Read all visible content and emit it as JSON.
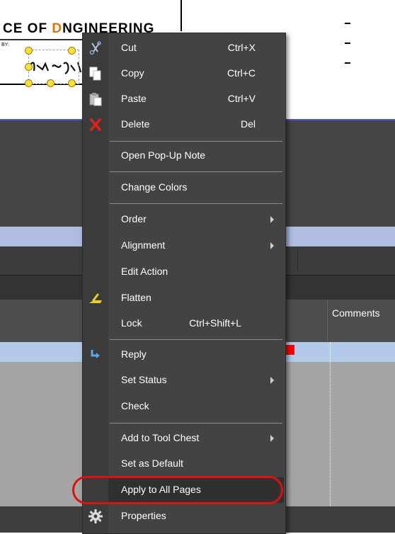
{
  "document": {
    "title_prefix": "CE OF ",
    "title_highlight": "D",
    "title_suffix": "NGINEERING",
    "small_label": "BY:",
    "dashes": [
      "-",
      "-",
      "-"
    ]
  },
  "grid": {
    "comments_header": "Comments"
  },
  "context_menu": {
    "items": [
      {
        "label": "Cut",
        "shortcut": "Ctrl+X",
        "icon": "scissors-icon"
      },
      {
        "label": "Copy",
        "shortcut": "Ctrl+C",
        "icon": "copy-icon"
      },
      {
        "label": "Paste",
        "shortcut": "Ctrl+V",
        "icon": "paste-icon"
      },
      {
        "label": "Delete",
        "shortcut": "Del",
        "icon": "delete-x-icon"
      },
      {
        "label": "Open Pop-Up Note",
        "shortcut": "",
        "icon": ""
      },
      {
        "label": "Change Colors",
        "shortcut": "",
        "icon": ""
      },
      {
        "label": "Order",
        "shortcut": "",
        "icon": "",
        "submenu": true
      },
      {
        "label": "Alignment",
        "shortcut": "",
        "icon": "",
        "submenu": true
      },
      {
        "label": "Edit Action",
        "shortcut": "",
        "icon": ""
      },
      {
        "label": "Flatten",
        "shortcut": "",
        "icon": "flatten-icon"
      },
      {
        "label": "Lock",
        "shortcut": "Ctrl+Shift+L",
        "icon": ""
      },
      {
        "label": "Reply",
        "shortcut": "",
        "icon": "reply-arrow-icon"
      },
      {
        "label": "Set Status",
        "shortcut": "",
        "icon": "",
        "submenu": true
      },
      {
        "label": "Check",
        "shortcut": "",
        "icon": ""
      },
      {
        "label": "Add to Tool Chest",
        "shortcut": "",
        "icon": "",
        "submenu": true
      },
      {
        "label": "Set as Default",
        "shortcut": "",
        "icon": ""
      },
      {
        "label": "Apply to All Pages",
        "shortcut": "",
        "icon": ""
      },
      {
        "label": "Properties",
        "shortcut": "",
        "icon": "gear-icon"
      }
    ]
  },
  "colors": {
    "highlight_ring": "#dd1111",
    "status_red": "#ff0000",
    "selection_row": "#b3cbe8"
  }
}
